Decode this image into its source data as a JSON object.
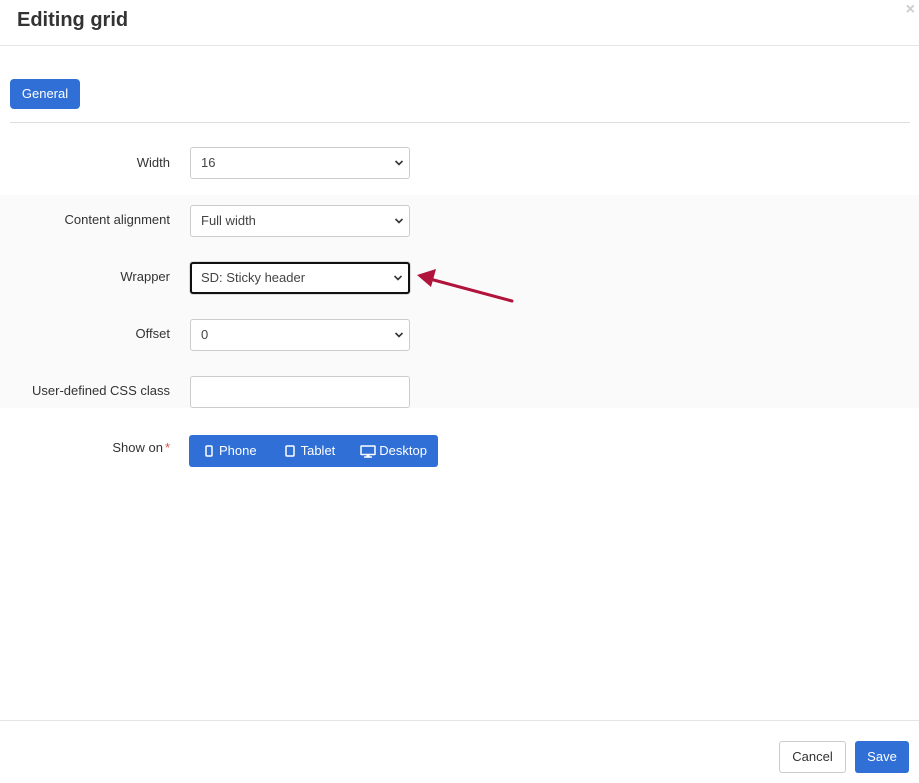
{
  "dialog": {
    "title": "Editing grid",
    "close_glyph": "×"
  },
  "tabs": [
    {
      "label": "General",
      "active": true
    }
  ],
  "form": {
    "width": {
      "label": "Width",
      "value": "16"
    },
    "content_alignment": {
      "label": "Content alignment",
      "value": "Full width"
    },
    "wrapper": {
      "label": "Wrapper",
      "value": "SD: Sticky header"
    },
    "offset": {
      "label": "Offset",
      "value": "0"
    },
    "css_class": {
      "label": "User-defined CSS class",
      "value": ""
    },
    "show_on": {
      "label": "Show on",
      "required_mark": "*",
      "options": [
        {
          "label": "Phone",
          "icon": "phone-icon"
        },
        {
          "label": "Tablet",
          "icon": "tablet-icon"
        },
        {
          "label": "Desktop",
          "icon": "desktop-icon"
        }
      ]
    }
  },
  "footer": {
    "cancel_label": "Cancel",
    "save_label": "Save"
  },
  "colors": {
    "primary": "#2f6fd6",
    "annotation_arrow": "#b0143a"
  }
}
